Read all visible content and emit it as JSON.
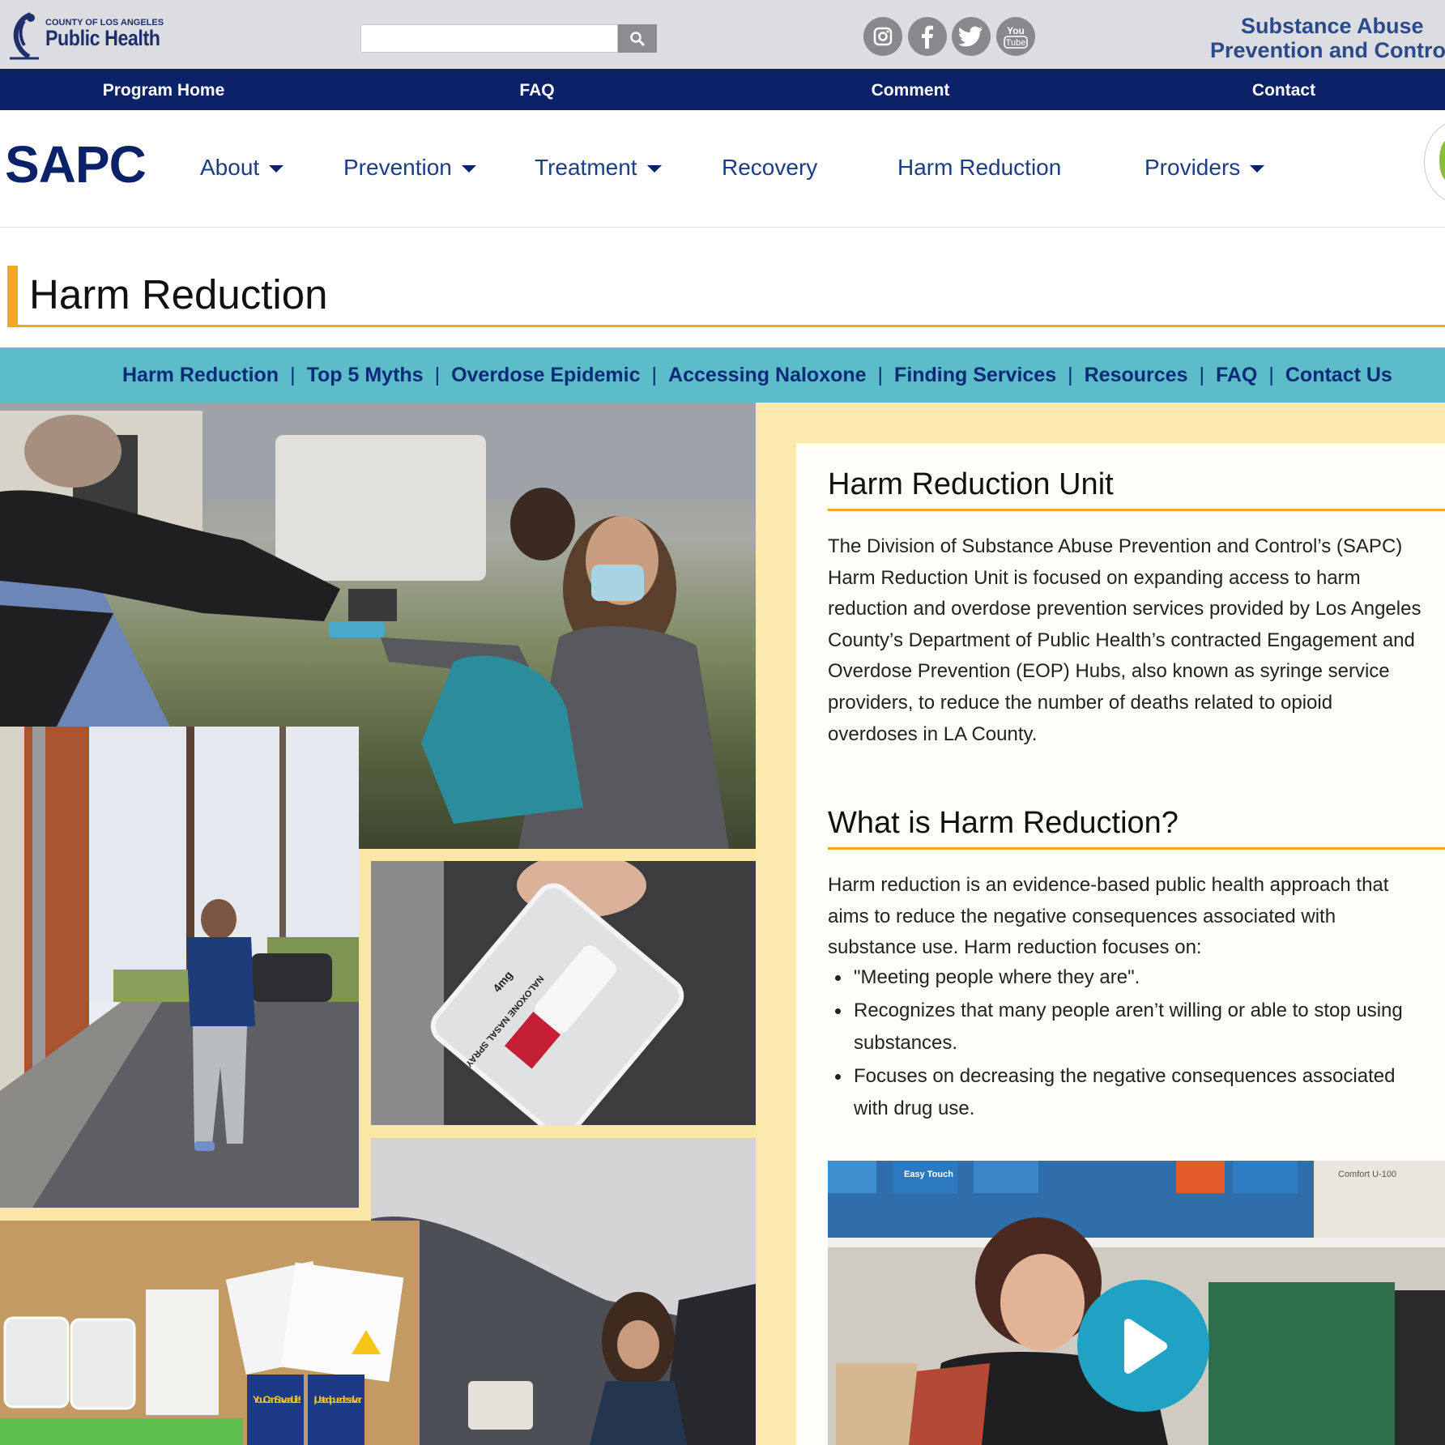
{
  "header": {
    "logo_small": "County of Los Angeles",
    "logo_big": "Public Health",
    "search_placeholder": "",
    "program_title_line1": "Substance Abuse",
    "program_title_line2": "Prevention and Control",
    "social": [
      "instagram-icon",
      "facebook-icon",
      "twitter-icon",
      "youtube-icon"
    ],
    "youtube_text_1": "You",
    "youtube_text_2": "Tube"
  },
  "utility_nav": [
    "Program Home",
    "FAQ",
    "Comment",
    "Contact"
  ],
  "main_nav": {
    "brand": "SAPC",
    "items": [
      {
        "label": "About",
        "dropdown": true
      },
      {
        "label": "Prevention",
        "dropdown": true
      },
      {
        "label": "Treatment",
        "dropdown": true
      },
      {
        "label": "Recovery",
        "dropdown": false
      },
      {
        "label": "Harm Reduction",
        "dropdown": false
      },
      {
        "label": "Providers",
        "dropdown": true
      }
    ]
  },
  "page_title": "Harm Reduction",
  "sub_nav": [
    "Harm Reduction",
    "Top 5 Myths",
    "Overdose Epidemic",
    "Accessing Naloxone",
    "Finding Services",
    "Resources",
    "FAQ",
    "Contact Us"
  ],
  "collage": {
    "naloxone_label": "NALOXONE NASAL SPRAY",
    "dose": "4mg",
    "card_text_1": "You Can Save a Life!",
    "card_text_2": "¡Usted puede salvar"
  },
  "section1": {
    "heading": "Harm Reduction Unit",
    "lines": [
      "The Division of Substance Abuse Prevention and Control’s (SAPC)",
      "Harm Reduction Unit is focused on expanding access to harm",
      "reduction and overdose prevention services provided by Los Angeles",
      "County’s Department of Public Health’s contracted Engagement and",
      "Overdose Prevention (EOP) Hubs, also known as syringe service",
      "providers, to reduce the number of deaths related to opioid",
      "overdoses in LA County."
    ]
  },
  "section2": {
    "heading": "What is Harm Reduction?",
    "lines": [
      "Harm reduction is an evidence-based public health approach that",
      "aims to reduce the negative consequences associated with",
      "substance use. Harm reduction focuses on:"
    ],
    "bullets": [
      [
        "\"Meeting people where they are\"."
      ],
      [
        "Recognizes that many people aren’t willing or able to stop using",
        "substances."
      ],
      [
        "Focuses on decreasing the negative consequences associated",
        "with drug use."
      ]
    ]
  },
  "video": {
    "shelf_label": "Easy Touch",
    "shelf_label_2": "Comfort U-100"
  },
  "colors": {
    "navy": "#0c2268",
    "accent_orange": "#f6a623",
    "teal": "#5cbcc7",
    "cream": "#fbe9ae",
    "play_blue": "#1fa2c4"
  }
}
